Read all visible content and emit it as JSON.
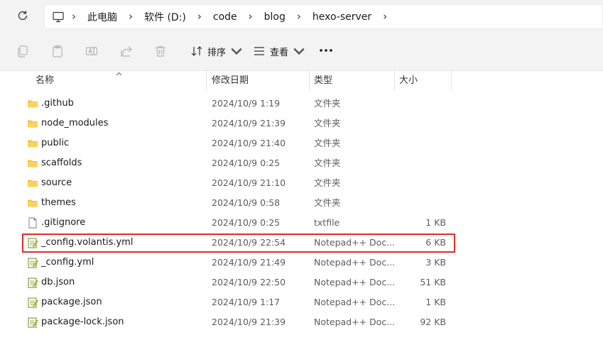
{
  "breadcrumb": [
    "此电脑",
    "软件 (D:)",
    "code",
    "blog",
    "hexo-server"
  ],
  "toolbar": {
    "sort_label": "排序",
    "view_label": "查看"
  },
  "columns": {
    "name": "名称",
    "date": "修改日期",
    "type": "类型",
    "size": "大小"
  },
  "files": [
    {
      "name": ".github",
      "date": "2024/10/9 1:19",
      "type": "文件夹",
      "size": "",
      "icon": "folder-icon"
    },
    {
      "name": "node_modules",
      "date": "2024/10/9 21:39",
      "type": "文件夹",
      "size": "",
      "icon": "folder-icon"
    },
    {
      "name": "public",
      "date": "2024/10/9 21:40",
      "type": "文件夹",
      "size": "",
      "icon": "folder-icon"
    },
    {
      "name": "scaffolds",
      "date": "2024/10/9 0:25",
      "type": "文件夹",
      "size": "",
      "icon": "folder-icon"
    },
    {
      "name": "source",
      "date": "2024/10/9 21:10",
      "type": "文件夹",
      "size": "",
      "icon": "folder-icon"
    },
    {
      "name": "themes",
      "date": "2024/10/9 0:58",
      "type": "文件夹",
      "size": "",
      "icon": "folder-icon"
    },
    {
      "name": ".gitignore",
      "date": "2024/10/9 0:25",
      "type": "txtfile",
      "size": "1 KB",
      "icon": "text-file-icon"
    },
    {
      "name": "_config.volantis.yml",
      "date": "2024/10/9 22:54",
      "type": "Notepad++ Doc...",
      "size": "6 KB",
      "icon": "notepad-file-icon"
    },
    {
      "name": "_config.yml",
      "date": "2024/10/9 21:49",
      "type": "Notepad++ Doc...",
      "size": "3 KB",
      "icon": "notepad-file-icon"
    },
    {
      "name": "db.json",
      "date": "2024/10/9 22:50",
      "type": "Notepad++ Doc...",
      "size": "51 KB",
      "icon": "notepad-file-icon"
    },
    {
      "name": "package.json",
      "date": "2024/10/9 1:17",
      "type": "Notepad++ Doc...",
      "size": "1 KB",
      "icon": "notepad-file-icon"
    },
    {
      "name": "package-lock.json",
      "date": "2024/10/9 21:39",
      "type": "Notepad++ Doc...",
      "size": "92 KB",
      "icon": "notepad-file-icon"
    }
  ],
  "highlighted_file": "_config.volantis.yml",
  "colors": {
    "highlight_border": "#e02b2b",
    "folder": "#f4c23d",
    "background": "#f3f3f3"
  }
}
